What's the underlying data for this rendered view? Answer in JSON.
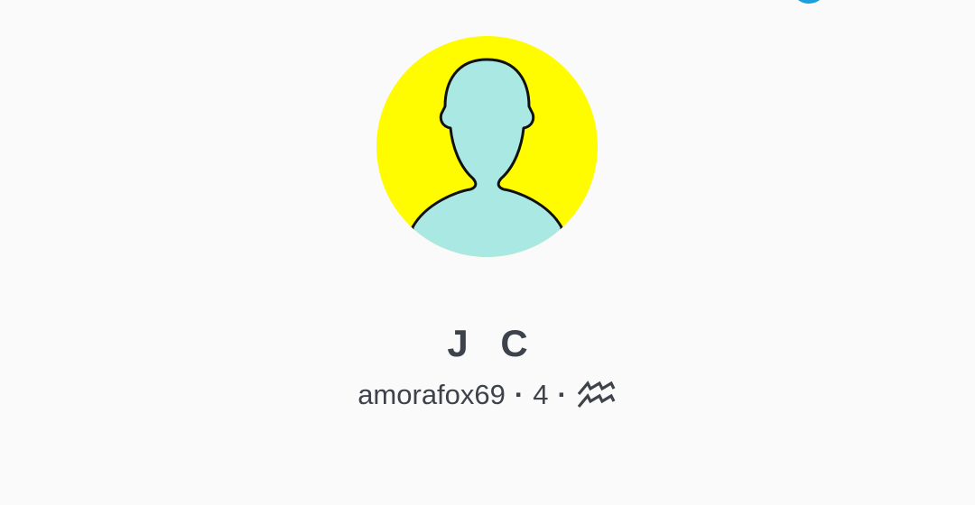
{
  "profile": {
    "display_name": "J C",
    "username": "amorafox69",
    "separator": "·",
    "snap_score": "4",
    "zodiac_icon": "aquarius-icon"
  },
  "colors": {
    "background": "#fafafa",
    "avatar_background": "#fffc00",
    "avatar_figure": "#a9e8e3",
    "text": "#3e434b",
    "accent": "#1aa0dc"
  }
}
